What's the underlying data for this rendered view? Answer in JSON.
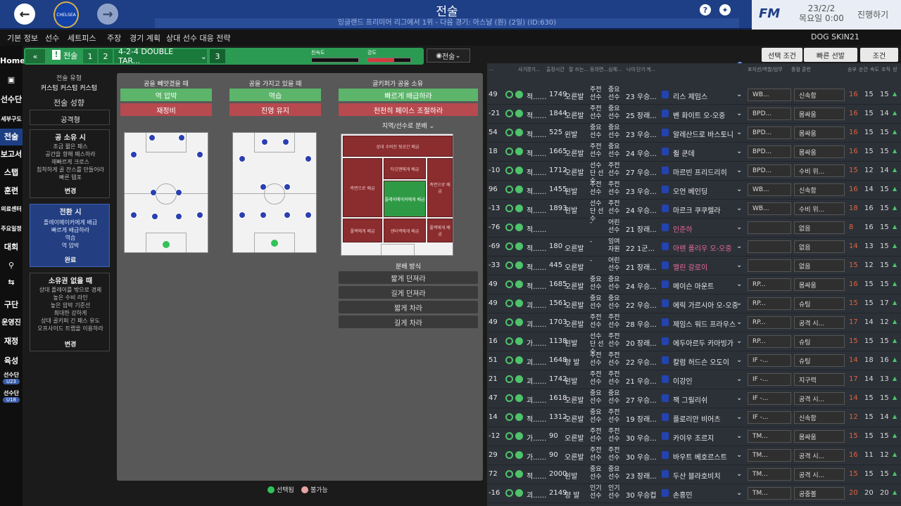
{
  "topbar": {
    "back": "←",
    "forward": "→",
    "club": "CHELSEA",
    "title": "전술",
    "subtitle": "잉글랜드 프리미어 리그에서 1위 - 다음 경기: 아스날 (원) (2일) (ID:630)",
    "help": "?",
    "date_line1": "23/2/2",
    "date_line2": "목요일 0:00",
    "continue": "진행하기",
    "fm": "FM"
  },
  "menu": [
    "기본 정보",
    "선수",
    "세트피스",
    "주장",
    "경기 계획",
    "상대 선수 대응 전략"
  ],
  "skin": "DOG SKIN21",
  "leftnav": [
    "Home",
    "트위치",
    "선수단",
    "세부구도",
    "전술",
    "보고서",
    "스탭",
    "훈련",
    "의료센터",
    "주요일정",
    "대회",
    "검색",
    "이적",
    "구단",
    "운영진",
    "재정",
    "육성",
    "선수단",
    "선수단"
  ],
  "badges": [
    "U23",
    "U18"
  ],
  "tactic": {
    "collapse": "«",
    "tactic_label": "전술",
    "num1": "1",
    "num2": "2",
    "formation": "4-2-4 DOUBLE TAR...",
    "num3": "3",
    "familiarity": "친숙도",
    "intensity": "강도",
    "dropdown": "전술"
  },
  "leftcol": {
    "style_label": "전술 유형",
    "style_value": "커스텀 커스텀 커스텀",
    "mentality_label": "전술 성향",
    "mentality_value": "공격형",
    "possession_title": "공 소유 시",
    "possession_lines": [
      "조금 짧은 패스",
      "공간을 향해 패스하라",
      "재빠르게 크로스",
      "침착하게 골 찬스를 만들어라",
      "빠른 템포"
    ],
    "change": "변경",
    "transition_title": "전환 시",
    "transition_lines": [
      "플레이메이커에게 배급",
      "빠르게 배급하라",
      "역습",
      "역 압박"
    ],
    "done": "완료",
    "outof_title": "소유권 없을 때",
    "outof_lines": [
      "상대 플레이를 밖으로 경제",
      "높은 수비 라인",
      "높은 압박 기준선",
      "최대한 강하게",
      "상대 골키퍼 긴 패스 유도",
      "오프사이드 트랩을 이용하라"
    ]
  },
  "panel": {
    "col1_title": "공을 빼앗겼을 때",
    "col1_btn1": "역 압박",
    "col1_btn2": "재정비",
    "col2_title": "공을 가지고 있을 때",
    "col2_btn1": "역습",
    "col2_btn2": "진영 유지",
    "col3_title": "골키퍼가 공을 소유",
    "col3_btn1": "빠르게 배급하라",
    "col3_btn2": "천천히 페이스 조절하라",
    "dist_title": "지역/선수로 분배",
    "zones": [
      "상대 수비진 뒷공간 배급",
      "측면으로 배급",
      "타깃맨에게 배급",
      "측면으로 배급",
      "플레이메이커에게 배급",
      "풀백에게 배급",
      "센터백에게 배급",
      "풀백에게 배급"
    ],
    "method_title": "분배 방식",
    "methods": [
      "짧게 던져라",
      "길게 던져라",
      "짧게 차라",
      "길게 차라"
    ],
    "legend_selected": "선택됨",
    "legend_disabled": "불가능"
  },
  "filters": [
    "선택 조건",
    "빠른 선발",
    "조건"
  ],
  "list_headers": [
    "...",
    "사기",
    "경기...",
    "출장시간",
    "잘 쓰는...",
    "등의면...",
    "심체...",
    "나이",
    "단기",
    "계...",
    "",
    "",
    "포지션/역할/임무",
    "",
    "",
    "중점 훈련",
    "승부",
    "순간",
    "속도",
    "조직",
    "성"
  ],
  "players": [
    {
      "num": "49",
      "reln": "적......",
      "val": "1749",
      "foot": "오른발",
      "pos": "주전 선수",
      "stat": "중요 선수",
      "age": "23 우승...",
      "name": "리스 제임스",
      "role": "WB...",
      "duty": "신속함",
      "a": "16",
      "b": "15",
      "c": "15",
      "hl": false
    },
    {
      "num": "-21",
      "reln": "적......",
      "val": "1844",
      "foot": "오른발",
      "pos": "주전 선수",
      "stat": "중요 선수",
      "age": "25 장래...",
      "name": "벤 화이트 오-오중",
      "role": "BPD...",
      "duty": "몸싸움",
      "a": "16",
      "b": "15",
      "c": "14",
      "hl": false
    },
    {
      "num": "54",
      "reln": "적......",
      "val": "525",
      "foot": "왼발",
      "pos": "중요 선수",
      "stat": "중요 선수",
      "age": "23 우승...",
      "name": "알레산드로 바스토니",
      "role": "BPD...",
      "duty": "몸싸움",
      "a": "16",
      "b": "15",
      "c": "15",
      "hl": false
    },
    {
      "num": "18",
      "reln": "적......",
      "val": "1665",
      "foot": "오른발",
      "pos": "주전 선수",
      "stat": "중요 선수",
      "age": "24 우승...",
      "name": "쥘 쿤데",
      "role": "BPD...",
      "duty": "몸싸움",
      "a": "16",
      "b": "15",
      "c": "15",
      "hl": false
    },
    {
      "num": "-10",
      "reln": "적......",
      "val": "1712",
      "foot": "오른발",
      "pos": "선수단 선수",
      "stat": "주전 선수",
      "age": "27 우승...",
      "name": "마르빈 프리드리히",
      "role": "BPD...",
      "duty": "수비 위...",
      "a": "15",
      "b": "12",
      "c": "14",
      "hl": false
    },
    {
      "num": "96",
      "reln": "적......",
      "val": "1455",
      "foot": "왼발",
      "pos": "주전 선수",
      "stat": "주전 선수",
      "age": "23 우승...",
      "name": "오언 베인딩",
      "role": "WB...",
      "duty": "신속함",
      "a": "16",
      "b": "14",
      "c": "15",
      "hl": false
    },
    {
      "num": "-13",
      "reln": "적......",
      "val": "1893",
      "foot": "왼발",
      "pos": "선수단 선수",
      "stat": "주전 선수",
      "age": "24 우승...",
      "name": "마르크 쿠쿠렐라",
      "role": "WB...",
      "duty": "수비 위...",
      "a": "18",
      "b": "16",
      "c": "15",
      "hl": false
    },
    {
      "num": "-76",
      "reln": "적......",
      "val": "",
      "foot": "",
      "pos": "-",
      "stat": "어린 선수",
      "age": "21 장래...",
      "name": "인준하",
      "role": "",
      "duty": "없음",
      "a": "8",
      "b": "16",
      "c": "15",
      "hl": true
    },
    {
      "num": "-69",
      "reln": "적......",
      "val": "180",
      "foot": "오른발",
      "pos": "-",
      "stat": "잉여 자원",
      "age": "22 1군...",
      "name": "아렌 폴리우 오-오중",
      "role": "",
      "duty": "없음",
      "a": "14",
      "b": "13",
      "c": "15",
      "hl": true
    },
    {
      "num": "-33",
      "reln": "적......",
      "val": "445",
      "foot": "오른발",
      "pos": "-",
      "stat": "어린 선수",
      "age": "21 장래...",
      "name": "멜린 갈로이",
      "role": "",
      "duty": "없음",
      "a": "15",
      "b": "12",
      "c": "15",
      "hl": true
    },
    {
      "num": "49",
      "reln": "적......",
      "val": "1685",
      "foot": "오른발",
      "pos": "중요 선수",
      "stat": "중요 선수",
      "age": "24 우승...",
      "name": "메이슨 마운트",
      "role": "RP...",
      "duty": "몸싸움",
      "a": "16",
      "b": "15",
      "c": "15",
      "hl": false
    },
    {
      "num": "49",
      "reln": "괴......",
      "val": "1561",
      "foot": "오른발",
      "pos": "중요 선수",
      "stat": "중요 선수",
      "age": "22 우승...",
      "name": "에릭 가르시아 오-오중",
      "role": "RP...",
      "duty": "슈팅",
      "a": "15",
      "b": "15",
      "c": "17",
      "hl": false
    },
    {
      "num": "49",
      "reln": "괴......",
      "val": "1703",
      "foot": "오른발",
      "pos": "주전 선수",
      "stat": "주전 선수",
      "age": "28 우승...",
      "name": "제임스 워드 프라우스",
      "role": "RP...",
      "duty": "공격 시...",
      "a": "17",
      "b": "14",
      "c": "12",
      "hl": false
    },
    {
      "num": "16",
      "reln": "가......",
      "val": "1138",
      "foot": "왼발",
      "pos": "선수단 선수",
      "stat": "주전 선수",
      "age": "20 장래...",
      "name": "에두아르두 카마빙가",
      "role": "RP...",
      "duty": "슈팅",
      "a": "15",
      "b": "15",
      "c": "15",
      "hl": false
    },
    {
      "num": "51",
      "reln": "괴......",
      "val": "1648",
      "foot": "양 발",
      "pos": "주전 선수",
      "stat": "주전 선수",
      "age": "22 우승...",
      "name": "칼럼 허드슨 오도이",
      "role": "IF -...",
      "duty": "슈팅",
      "a": "14",
      "b": "18",
      "c": "16",
      "hl": false
    },
    {
      "num": "21",
      "reln": "괴......",
      "val": "1742",
      "foot": "왼발",
      "pos": "주전 선수",
      "stat": "주전 선수",
      "age": "21 우승...",
      "name": "이강인",
      "role": "IF -...",
      "duty": "지구력",
      "a": "17",
      "b": "14",
      "c": "13",
      "hl": false
    },
    {
      "num": "47",
      "reln": "괴......",
      "val": "1618",
      "foot": "오른발",
      "pos": "중요 선수",
      "stat": "중요 선수",
      "age": "27 우승...",
      "name": "잭 그릴리쉬",
      "role": "IF -...",
      "duty": "공격 시...",
      "a": "14",
      "b": "15",
      "c": "15",
      "hl": false
    },
    {
      "num": "14",
      "reln": "적......",
      "val": "1312",
      "foot": "오른발",
      "pos": "중요 선수",
      "stat": "주전 선수",
      "age": "19 장래...",
      "name": "플로리안 비어츠",
      "role": "IF -...",
      "duty": "신속함",
      "a": "12",
      "b": "15",
      "c": "14",
      "hl": false
    },
    {
      "num": "-12",
      "reln": "가......",
      "val": "90",
      "foot": "오른발",
      "pos": "주전 선수",
      "stat": "주전 선수",
      "age": "30 우승...",
      "name": "카이우 조르지",
      "role": "TM...",
      "duty": "몸싸움",
      "a": "15",
      "b": "15",
      "c": "15",
      "hl": false
    },
    {
      "num": "29",
      "reln": "가......",
      "val": "90",
      "foot": "오른발",
      "pos": "주전 선수",
      "stat": "주전 선수",
      "age": "30 우승...",
      "name": "바우트 베호르스트",
      "role": "TM...",
      "duty": "공격 시...",
      "a": "16",
      "b": "11",
      "c": "12",
      "hl": false
    },
    {
      "num": "72",
      "reln": "적......",
      "val": "2000",
      "foot": "왼발",
      "pos": "중요 선수",
      "stat": "중요 선수",
      "age": "23 장래...",
      "name": "두산 블라호비치",
      "role": "TM...",
      "duty": "공격 시...",
      "a": "15",
      "b": "15",
      "c": "15",
      "hl": false
    },
    {
      "num": "-16",
      "reln": "괴......",
      "val": "2149",
      "foot": "양 발",
      "pos": "인기 선수",
      "stat": "인기 선수",
      "age": "30 우승컵",
      "name": "손흥민",
      "role": "TM...",
      "duty": "공중볼",
      "a": "20",
      "b": "20",
      "c": "20",
      "hl": false
    }
  ],
  "colors": {
    "accent": "#1e3f86",
    "tactic_green": "#2b9a53",
    "green_btn": "#5cb56a",
    "red_btn": "#b74a4f"
  }
}
